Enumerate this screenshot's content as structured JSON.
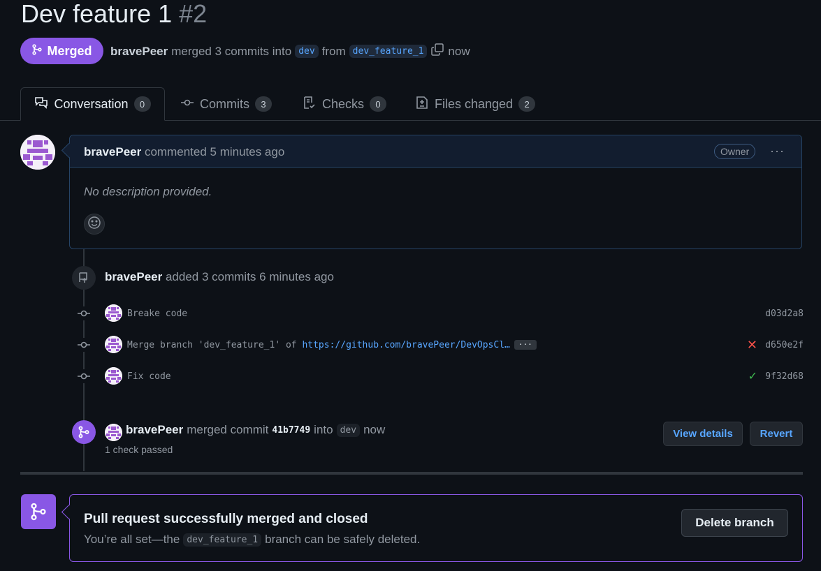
{
  "pr": {
    "title": "Dev feature 1",
    "number": "#2",
    "state": "Merged",
    "author": "bravePeer",
    "merge_phrase": "merged 3 commits into",
    "base_branch": "dev",
    "from_word": "from",
    "head_branch": "dev_feature_1",
    "when": "now"
  },
  "tabs": [
    {
      "label": "Conversation",
      "count": "0",
      "icon": "comment-discussion-icon"
    },
    {
      "label": "Commits",
      "count": "3",
      "icon": "git-commit-icon"
    },
    {
      "label": "Checks",
      "count": "0",
      "icon": "checklist-icon"
    },
    {
      "label": "Files changed",
      "count": "2",
      "icon": "file-diff-icon"
    }
  ],
  "comment": {
    "author": "bravePeer",
    "action": "commented 5 minutes ago",
    "role_badge": "Owner",
    "menu": "···",
    "body": "No description provided."
  },
  "timeline": {
    "added": {
      "author": "bravePeer",
      "text": "added 3 commits 6 minutes ago"
    },
    "commits": [
      {
        "message": "Breake code",
        "link": "",
        "sha": "d03d2a8",
        "status": "none"
      },
      {
        "message": "Merge branch 'dev_feature_1' of ",
        "link": "https://github.com/bravePeer/DevOpsCl…",
        "ellipsis": "···",
        "sha": "d650e2f",
        "status": "fail"
      },
      {
        "message": "Fix code",
        "link": "",
        "sha": "9f32d68",
        "status": "success"
      }
    ],
    "merged": {
      "author": "bravePeer",
      "phrase": "merged commit",
      "sha": "41b7749",
      "into": "into",
      "branch": "dev",
      "when": "now",
      "checks": "1 check passed",
      "view_details": "View details",
      "revert": "Revert"
    }
  },
  "merge_box": {
    "title": "Pull request successfully merged and closed",
    "sub_before": "You’re all set—the",
    "branch": "dev_feature_1",
    "sub_after": "branch can be safely deleted.",
    "delete_button": "Delete branch"
  },
  "colors": {
    "background": "#0d1117",
    "merged_purple": "#8957e5",
    "link_blue": "#58a6ff",
    "fail_red": "#f85149",
    "success_green": "#3fb950"
  }
}
